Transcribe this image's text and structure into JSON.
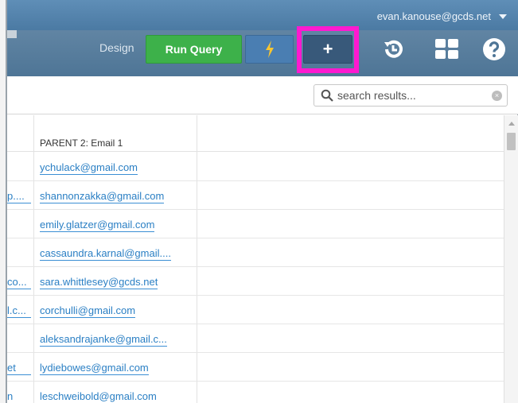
{
  "header": {
    "user_email": "evan.kanouse@gcds.net",
    "design_label": "Design",
    "run_query_label": "Run Query",
    "plus_label": "+",
    "accent_color": "#ff19d0"
  },
  "icons": {
    "bolt": "bolt-icon",
    "history": "history-icon",
    "grid": "grid-icon",
    "help": "help-icon",
    "search": "search-icon",
    "clear": "clear-icon"
  },
  "search": {
    "placeholder": "search results..."
  },
  "table": {
    "column_header": "PARENT 2: Email 1",
    "rows": [
      {
        "prev": "",
        "email": "ychulack@gmail.com"
      },
      {
        "prev": "p....",
        "email": "shannonzakka@gmail.com"
      },
      {
        "prev": "",
        "email": "emily.glatzer@gmail.com"
      },
      {
        "prev": "",
        "email": "cassaundra.karnal@gmail...."
      },
      {
        "prev": "co...",
        "email": "sara.whittlesey@gcds.net"
      },
      {
        "prev": "l.c...",
        "email": "corchulli@gmail.com"
      },
      {
        "prev": "",
        "email": "aleksandrajanke@gmail.c..."
      },
      {
        "prev": "et",
        "email": "lydiebowes@gmail.com"
      },
      {
        "prev": "n",
        "email": "leschweibold@gmail.com"
      }
    ]
  }
}
